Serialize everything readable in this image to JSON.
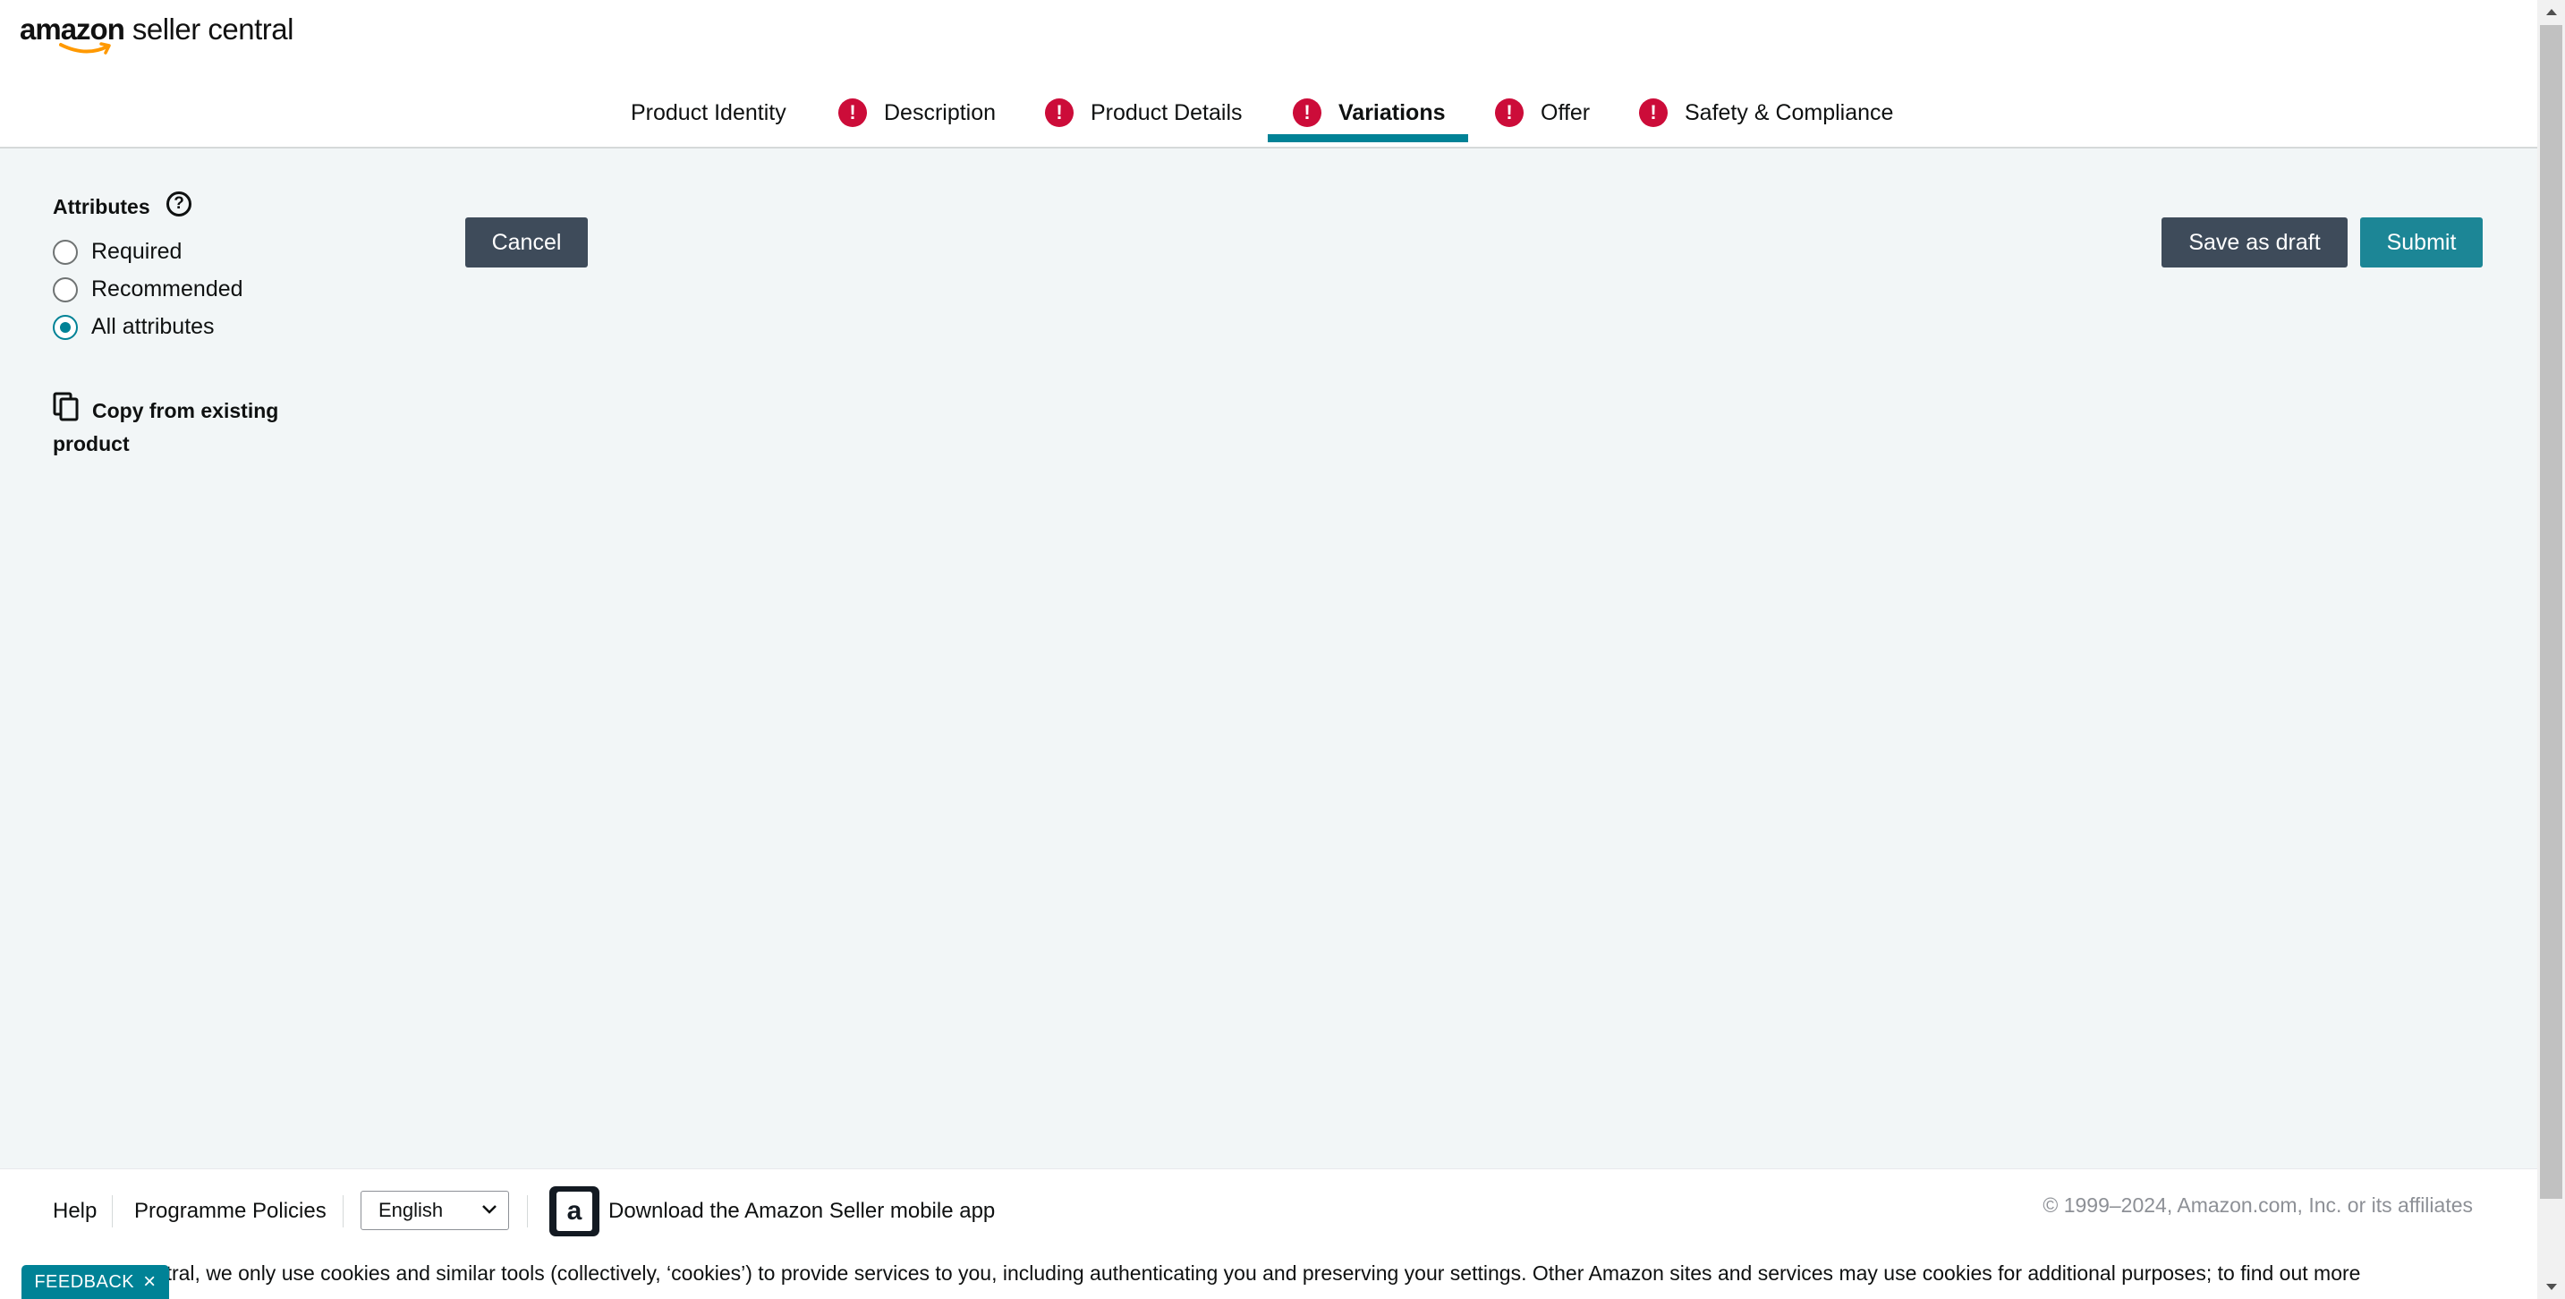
{
  "brand": {
    "logo_word": "amazon",
    "logo_suffix": "seller central",
    "accent_color": "#008296",
    "alert_color": "#cc0c39"
  },
  "tabs": [
    {
      "label": "Product Identity",
      "alert": false,
      "active": false
    },
    {
      "label": "Description",
      "alert": true,
      "active": false
    },
    {
      "label": "Product Details",
      "alert": true,
      "active": false
    },
    {
      "label": "Variations",
      "alert": true,
      "active": true
    },
    {
      "label": "Offer",
      "alert": true,
      "active": false
    },
    {
      "label": "Safety & Compliance",
      "alert": true,
      "active": false
    }
  ],
  "sidebar": {
    "title": "Attributes",
    "help_icon": "question-circle-icon",
    "options": [
      {
        "label": "Required",
        "checked": false
      },
      {
        "label": "Recommended",
        "checked": false
      },
      {
        "label": "All attributes",
        "checked": true
      }
    ],
    "copy_link": "Copy from existing product"
  },
  "actions": {
    "cancel": "Cancel",
    "save_draft": "Save as draft",
    "submit": "Submit"
  },
  "footer": {
    "help": "Help",
    "policies": "Programme Policies",
    "language": "English",
    "app_link": "Download the Amazon Seller mobile app",
    "copyright": "© 1999–2024, Amazon.com, Inc. or its affiliates",
    "cookie_notice": "entral, we only use cookies and similar tools (collectively, ‘cookies’) to provide services to you, including authenticating you and preserving your settings. Other Amazon sites and services may use cookies for additional purposes; to find out more",
    "feedback": "FEEDBACK"
  }
}
